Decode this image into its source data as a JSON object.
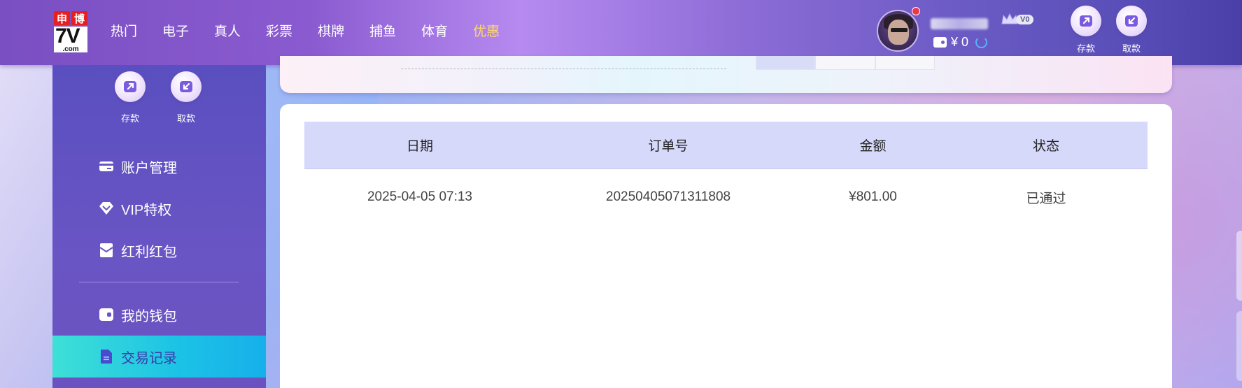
{
  "header": {
    "logo": {
      "top_left": "申",
      "top_right": "博",
      "main": "7V",
      "sub": ".com"
    },
    "nav": [
      {
        "label": "热门",
        "active": false
      },
      {
        "label": "电子",
        "active": false
      },
      {
        "label": "真人",
        "active": false
      },
      {
        "label": "彩票",
        "active": false
      },
      {
        "label": "棋牌",
        "active": false
      },
      {
        "label": "捕鱼",
        "active": false
      },
      {
        "label": "体育",
        "active": false
      },
      {
        "label": "优惠",
        "active": true
      }
    ],
    "vip_level": "V0",
    "balance": "¥ 0",
    "deposit_label": "存款",
    "withdraw_label": "取款"
  },
  "sidebar": {
    "deposit_label": "存款",
    "withdraw_label": "取款",
    "items": [
      {
        "label": "账户管理",
        "icon": "card-icon"
      },
      {
        "label": "VIP特权",
        "icon": "diamond-icon"
      },
      {
        "label": "红利红包",
        "icon": "envelope-icon"
      },
      {
        "label": "我的钱包",
        "icon": "wallet-icon"
      },
      {
        "label": "交易记录",
        "icon": "document-icon",
        "active": true
      }
    ]
  },
  "table": {
    "headers": [
      "日期",
      "订单号",
      "金额",
      "状态"
    ],
    "rows": [
      {
        "date": "2025-04-05 07:13",
        "order_no": "20250405071311808",
        "amount": "¥801.00",
        "status": "已通过"
      }
    ]
  },
  "colors": {
    "accent": "#ffd86b",
    "active_item_gradient_start": "#3ee0d6",
    "active_item_gradient_end": "#16b0ea",
    "table_header_bg": "#d7d9fb"
  }
}
